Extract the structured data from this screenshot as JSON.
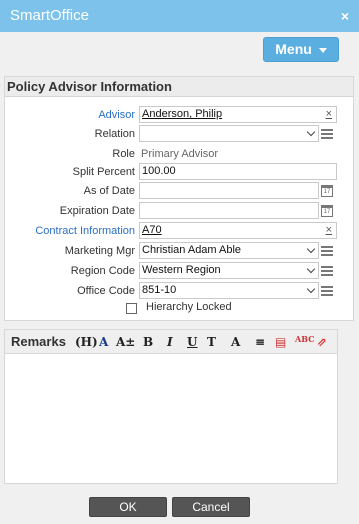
{
  "window": {
    "title": "SmartOffice",
    "close_glyph": "×"
  },
  "toolbar": {
    "menu_label": "Menu"
  },
  "section": {
    "title": "Policy Advisor Information"
  },
  "fields": {
    "advisor": {
      "label": "Advisor",
      "value": "Anderson, Philip"
    },
    "relation": {
      "label": "Relation",
      "value": ""
    },
    "role": {
      "label": "Role",
      "value": "Primary Advisor"
    },
    "split_percent": {
      "label": "Split Percent",
      "value": "100.00"
    },
    "as_of_date": {
      "label": "As of Date",
      "value": ""
    },
    "expiration_date": {
      "label": "Expiration Date",
      "value": ""
    },
    "contract_information": {
      "label": "Contract Information",
      "value": "A70"
    },
    "marketing_mgr": {
      "label": "Marketing Mgr",
      "value": "Christian Adam Able"
    },
    "region_code": {
      "label": "Region Code",
      "value": "Western Region"
    },
    "office_code": {
      "label": "Office Code",
      "value": "851-10"
    }
  },
  "hierarchy_locked": {
    "label": "Hierarchy Locked",
    "checked": false
  },
  "remarks": {
    "label": "Remarks",
    "tools": [
      "(H)",
      "A",
      "A±",
      "B",
      "I",
      "U",
      "T",
      "A",
      "≡",
      "▤",
      "ABC",
      "⇗"
    ]
  },
  "buttons": {
    "ok": "OK",
    "cancel": "Cancel"
  },
  "colors": {
    "titlebar": "#7cc2ea",
    "menu_button": "#5aaee0",
    "link": "#2b6fc4",
    "button": "#555555"
  }
}
